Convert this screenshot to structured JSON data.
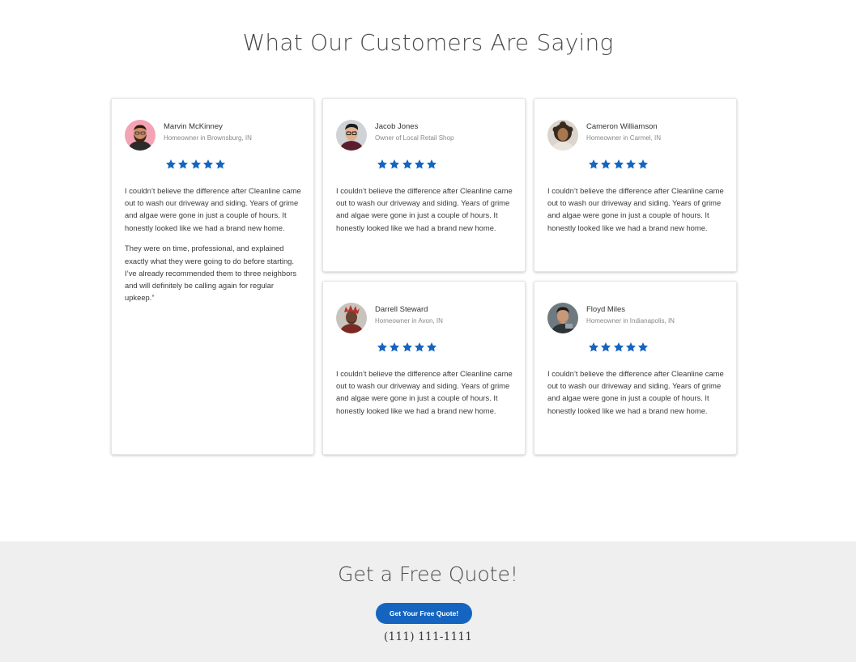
{
  "testimonials": {
    "title": "What Our Customers Are Saying",
    "accent_color": "#1565c0",
    "star_icon": "star-icon",
    "rating": 5,
    "items": [
      {
        "name": "Marvin McKinney",
        "role": "Homeowner in Brownsburg, IN",
        "paragraphs": [
          "I couldn’t believe the difference after Cleanline came out to wash our driveway and siding. Years of grime and algae were gone in just a couple of hours. It honestly looked like we had a brand new home.",
          "They were on time, professional, and explained exactly what they were going to do before starting. I’ve already recommended them to three neighbors and will definitely be calling again for regular upkeep.”"
        ]
      },
      {
        "name": "Jacob Jones",
        "role": "Owner of Local Retail Shop",
        "paragraphs": [
          "I couldn’t believe the difference after Cleanline came out to wash our driveway and siding. Years of grime and algae were gone in just a couple of hours. It honestly looked like we had a brand new home."
        ]
      },
      {
        "name": "Cameron Williamson",
        "role": "Homeowner in Carmel, IN",
        "paragraphs": [
          "I couldn’t believe the difference after Cleanline came out to wash our driveway and siding. Years of grime and algae were gone in just a couple of hours. It honestly looked like we had a brand new home."
        ]
      },
      {
        "name": "Darrell Steward",
        "role": "Homeowner in Avon, IN",
        "paragraphs": [
          "I couldn’t believe the difference after Cleanline came out to wash our driveway and siding. Years of grime and algae were gone in just a couple of hours. It honestly looked like we had a brand new home."
        ]
      },
      {
        "name": "Floyd Miles",
        "role": "Homeowner in Indianapolis, IN",
        "paragraphs": [
          "I couldn’t believe the difference after Cleanline came out to wash our driveway and siding. Years of grime and algae were gone in just a couple of hours. It honestly looked like we had a brand new home."
        ]
      }
    ]
  },
  "quote": {
    "title": "Get a Free Quote!",
    "button_label": "Get Your Free Quote!",
    "phone": "(111) 111-1111"
  }
}
